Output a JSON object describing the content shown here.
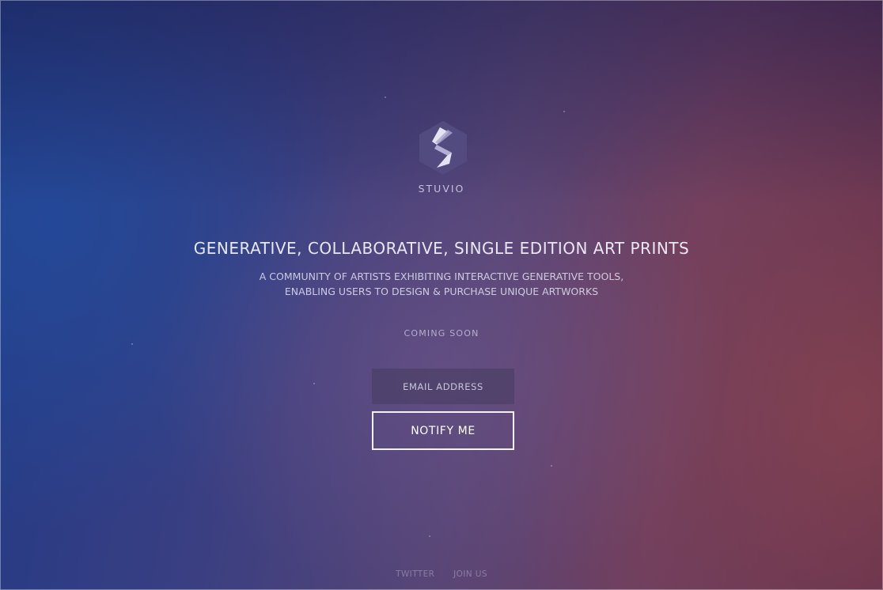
{
  "brand": {
    "name": "STUVIO",
    "logo_icon": "stuvio-hexagon-logo-icon"
  },
  "hero": {
    "headline": "GENERATIVE, COLLABORATIVE, SINGLE EDITION ART PRINTS",
    "subline_1": "A COMMUNITY OF ARTISTS EXHIBITING INTERACTIVE GENERATIVE TOOLS,",
    "subline_2": "ENABLING USERS TO DESIGN & PURCHASE UNIQUE ARTWORKS",
    "status": "COMING SOON"
  },
  "signup": {
    "email_placeholder": "EMAIL ADDRESS",
    "email_value": "",
    "notify_label": "NOTIFY ME"
  },
  "footer": {
    "links": [
      "TWITTER",
      "JOIN US"
    ]
  },
  "colors": {
    "gradient_left": "#223a86",
    "gradient_center": "#584575",
    "gradient_right": "#6b3e62",
    "text": "#ffffff"
  }
}
